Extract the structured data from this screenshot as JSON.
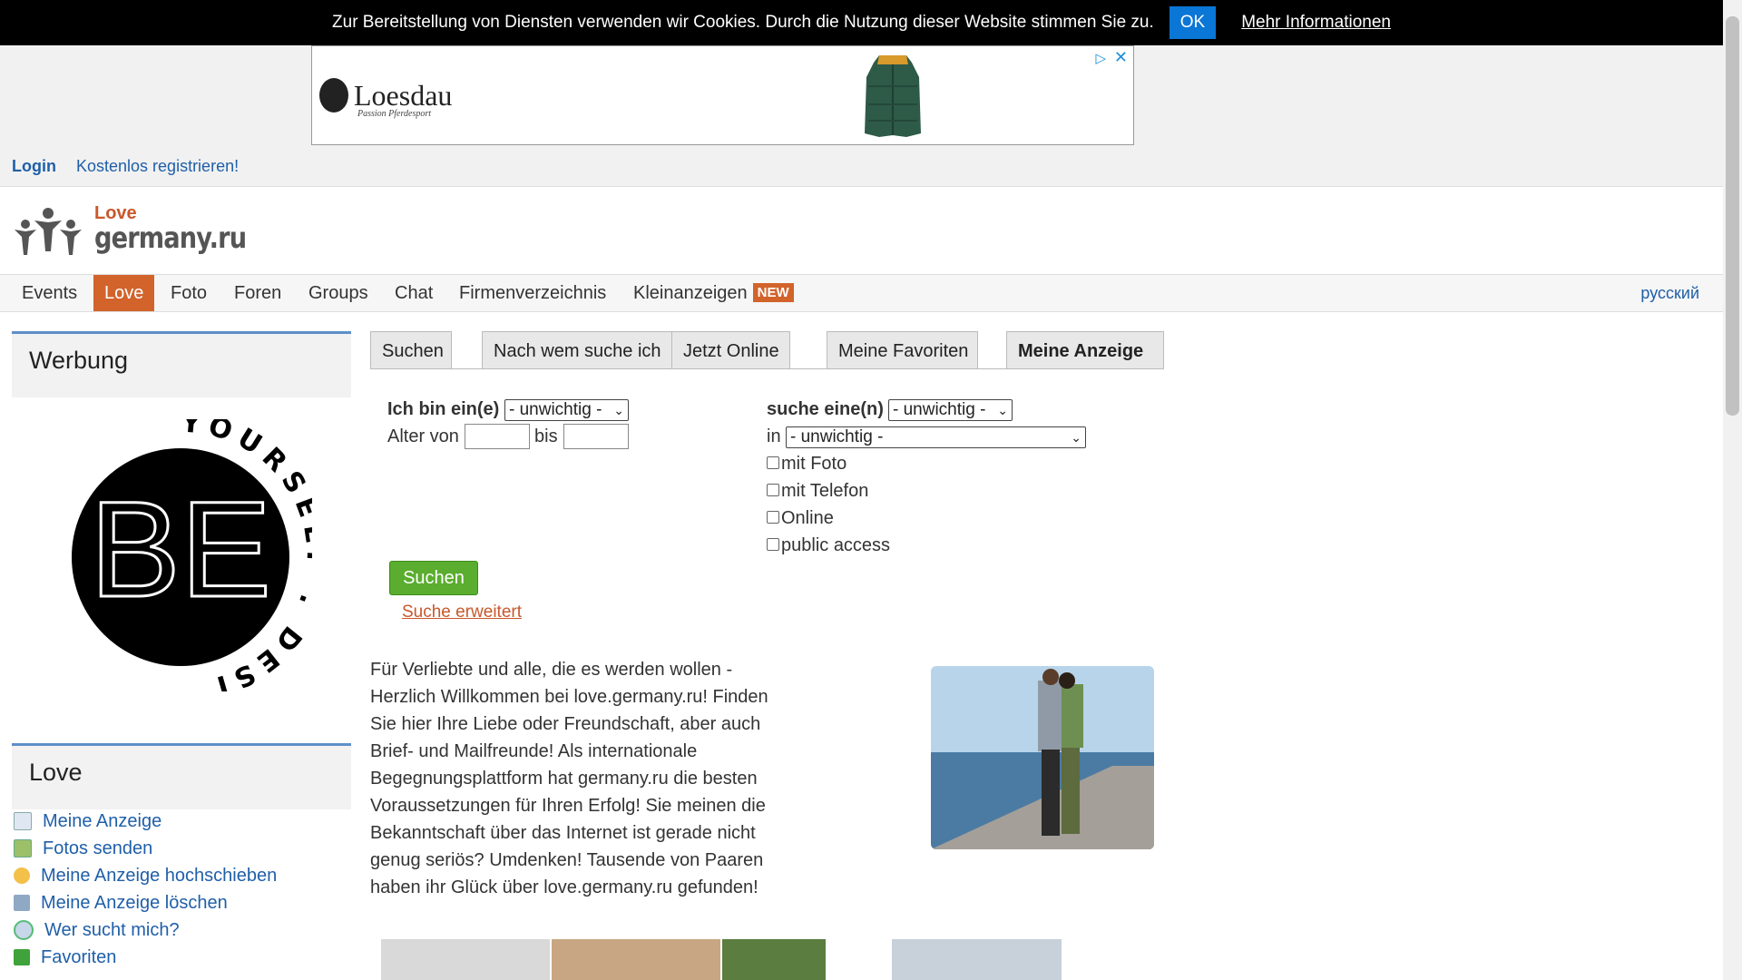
{
  "cookie": {
    "message": "Zur Bereitstellung von Diensten verwenden wir Cookies. Durch die Nutzung dieser Website stimmen Sie zu.",
    "ok": "OK",
    "more": "Mehr Informationen"
  },
  "ad": {
    "brand": "Loesdau",
    "tagline": "Passion Pferdesport"
  },
  "auth": {
    "login": "Login",
    "register": "Kostenlos registrieren!"
  },
  "logo": {
    "love": "Love",
    "site": "germany.ru"
  },
  "nav": {
    "items": [
      "Events",
      "Love",
      "Foto",
      "Foren",
      "Groups",
      "Chat",
      "Firmenverzeichnis",
      "Kleinanzeigen"
    ],
    "new_badge": "NEW",
    "lang": "русский",
    "active": "Love"
  },
  "sidebar": {
    "ads_title": "Werbung",
    "be": {
      "big": "BE",
      "ring": "YOURSELF . DESIGN"
    },
    "love_title": "Love",
    "love_items": [
      "Meine Anzeige",
      "Fotos senden",
      "Meine Anzeige hochschieben",
      "Meine Anzeige löschen",
      "Wer sucht mich?",
      "Favoriten"
    ]
  },
  "tabs": [
    "Suchen",
    "Nach wem suche ich",
    "Jetzt Online",
    "Meine Favoriten",
    "Meine Anzeige"
  ],
  "form": {
    "iam_label": "Ich bin ein(e)",
    "iam_value": "- unwichtig -",
    "age_from_label": "Alter von",
    "age_to_label": "bis",
    "seek_label": "suche eine(n)",
    "seek_value": "- unwichtig -",
    "in_label": "in",
    "in_value": "- unwichtig -",
    "checkboxes": [
      "mit Foto",
      "mit Telefon",
      "Online",
      "public access"
    ],
    "submit": "Suchen",
    "advanced": "Suche erweitert"
  },
  "intro": "Für Verliebte und alle, die es werden wollen - Herzlich Willkommen bei love.germany.ru! Finden Sie hier Ihre Liebe oder Freundschaft, aber auch Brief- und Mailfreunde! Als internationale Begegnungsplattform hat germany.ru die besten Voraussetzungen für Ihren Erfolg! Sie meinen die Bekanntschaft über das Internet ist gerade nicht genug seriös? Umdenken! Tausende von Paaren haben ihr Glück über love.germany.ru gefunden!",
  "colors": {
    "accent": "#d2632b",
    "link": "#1f5fa8",
    "button": "#5aad2e",
    "cookie_ok": "#0a76d6"
  }
}
